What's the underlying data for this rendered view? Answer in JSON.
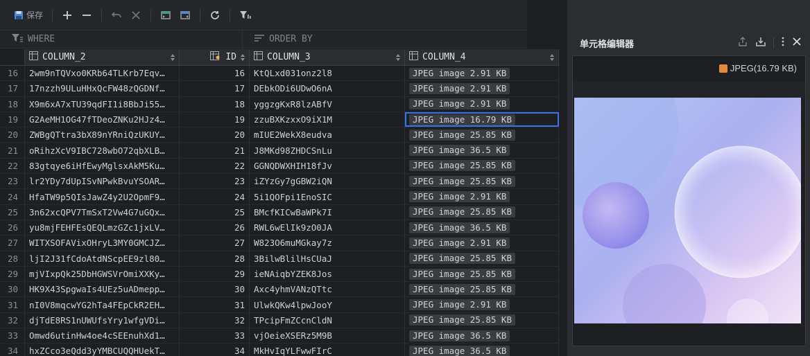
{
  "toolbar": {
    "save_label": "保存",
    "icons": [
      "save-icon",
      "add-icon",
      "remove-icon",
      "undo-icon",
      "cancel-icon",
      "import-icon",
      "export-icon",
      "refresh-icon",
      "filter-icon"
    ]
  },
  "filter": {
    "where_label": "WHERE",
    "orderby_label": "ORDER BY"
  },
  "columns": [
    "COLUMN_2",
    "ID",
    "COLUMN_3",
    "COLUMN_4"
  ],
  "rows": [
    {
      "num": "16",
      "c2": "2wm9nTQVxo0KRb64TLKrb7Eqv…",
      "id": "16",
      "c3": "KtQLxd031onz2l8",
      "c4": "JPEG image 2.91 KB"
    },
    {
      "num": "17",
      "c2": "17nzzh9ULuHHxQcFW48zQGDNf…",
      "id": "17",
      "c3": "DEbkODi6UDwO6nA",
      "c4": "JPEG image 2.91 KB"
    },
    {
      "num": "18",
      "c2": "X9m6xA7xTU39qdFI1i8BbJi55…",
      "id": "18",
      "c3": "yggzgKxR8lzABfV",
      "c4": "JPEG image 2.91 KB"
    },
    {
      "num": "19",
      "c2": "G2AeMH1OG47fTDeoZNKu2HJz4…",
      "id": "19",
      "c3": "zzuBXKzxxO9iX1M",
      "c4": "JPEG image 16.79 KB",
      "selected": true
    },
    {
      "num": "20",
      "c2": "ZWBgQTtra3bX89nYRniQzUKUY…",
      "id": "20",
      "c3": "mIUE2WekX8eudva",
      "c4": "JPEG image 25.85 KB"
    },
    {
      "num": "21",
      "c2": "oRihzXcV9IBC728wbO72qbXLB…",
      "id": "21",
      "c3": "J8MKd98ZHDCSnLu",
      "c4": "JPEG image 36.5 KB"
    },
    {
      "num": "22",
      "c2": "83gtqye6iHfEwyMglsxAkM5Ku…",
      "id": "22",
      "c3": "GGNQDWXHIH18fJv",
      "c4": "JPEG image 25.85 KB"
    },
    {
      "num": "23",
      "c2": "lr2YDy7dUpISvNPwkBvuYSOAR…",
      "id": "23",
      "c3": "iZYzGy7gGBW2iQN",
      "c4": "JPEG image 25.85 KB"
    },
    {
      "num": "24",
      "c2": "HfaTW9p5QIsJawZ4y2U2OpmF9…",
      "id": "24",
      "c3": "5i1QOFpi1EnoSIC",
      "c4": "JPEG image 2.91 KB"
    },
    {
      "num": "25",
      "c2": "3n62xcQPV7TmSxT2Vw4G7uGQx…",
      "id": "25",
      "c3": "BMcfKICwBaWPk7I",
      "c4": "JPEG image 25.85 KB"
    },
    {
      "num": "26",
      "c2": "yu8mjFEHFEsQEQLmzGZc1jxLV…",
      "id": "26",
      "c3": "RWL6wElIk9zO0JA",
      "c4": "JPEG image 36.5 KB"
    },
    {
      "num": "27",
      "c2": "WITXSOFAVixOHryL3MY0GMCJZ…",
      "id": "27",
      "c3": "W823O6muMGkay7z",
      "c4": "JPEG image 2.91 KB"
    },
    {
      "num": "28",
      "c2": "ljI2J31fCdoAtdNScpEE9zl80…",
      "id": "28",
      "c3": "3BilwBlilHsCUaJ",
      "c4": "JPEG image 25.85 KB"
    },
    {
      "num": "29",
      "c2": "mjVIxpQk25DbHGWSVrOmiXXKy…",
      "id": "29",
      "c3": "ieNAiqbYZEK8Jos",
      "c4": "JPEG image 25.85 KB"
    },
    {
      "num": "30",
      "c2": "HK9X43SpgwaIs4UEz5uADmepp…",
      "id": "30",
      "c3": "Axc4yhmVANzQTtc",
      "c4": "JPEG image 25.85 KB"
    },
    {
      "num": "31",
      "c2": "nI0V8mqcwYG2hTa4FEpCkR2EH…",
      "id": "31",
      "c3": "UlwkQKw4lpwJooY",
      "c4": "JPEG image 2.91 KB"
    },
    {
      "num": "32",
      "c2": "djTdE8RS1nUWUfsYry1wfgVDi…",
      "id": "32",
      "c3": "TPcipFmZCcnCldN",
      "c4": "JPEG image 25.85 KB"
    },
    {
      "num": "33",
      "c2": "Omwd6utinHw4oe4cSEEnuhXd1…",
      "id": "33",
      "c3": "vjOeieXSERz5M9B",
      "c4": "JPEG image 36.5 KB"
    },
    {
      "num": "34",
      "c2": "hxZCco3eQdd3yYMBCUQQHUekT…",
      "id": "34",
      "c3": "MkHvIqYLFwwFIrC",
      "c4": "JPEG image 36.5 KB"
    }
  ],
  "panel": {
    "title": "单元格编辑器",
    "file_info": "JPEG(16.79 KB)",
    "accent": "#3574f0"
  }
}
